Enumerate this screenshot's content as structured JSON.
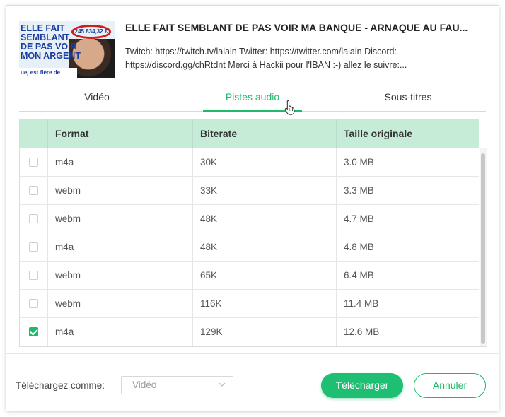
{
  "video": {
    "title": "ELLE FAIT SEMBLANT DE PAS VOIR MA BANQUE - ARNAQUE AU FAU...",
    "description": "Twitch: https://twitch.tv/lalain Twitter: https://twitter.com/lalain Discord: https://discord.gg/chRtdnt Merci à Hackii pour l'IBAN :-) allez le suivre:...",
    "thumbnail": {
      "text": "ELLE FAIT\nSEMBLANT\nDE PAS VOIR\nMON ARGENT",
      "amount": "245 834,32 €",
      "caption": "uej est fière de"
    }
  },
  "tabs": [
    {
      "label": "Vidéo",
      "active": false
    },
    {
      "label": "Pistes audio",
      "active": true
    },
    {
      "label": "Sous-titres",
      "active": false
    }
  ],
  "table": {
    "headers": [
      "Format",
      "Biterate",
      "Taille originale"
    ],
    "rows": [
      {
        "checked": false,
        "format": "m4a",
        "bitrate": "30K",
        "size": "3.0 MB"
      },
      {
        "checked": false,
        "format": "webm",
        "bitrate": "33K",
        "size": "3.3 MB"
      },
      {
        "checked": false,
        "format": "webm",
        "bitrate": "48K",
        "size": "4.7 MB"
      },
      {
        "checked": false,
        "format": "m4a",
        "bitrate": "48K",
        "size": "4.8 MB"
      },
      {
        "checked": false,
        "format": "webm",
        "bitrate": "65K",
        "size": "6.4 MB"
      },
      {
        "checked": false,
        "format": "webm",
        "bitrate": "116K",
        "size": "11.4 MB"
      },
      {
        "checked": true,
        "format": "m4a",
        "bitrate": "129K",
        "size": "12.6 MB"
      }
    ]
  },
  "footer": {
    "download_as_label": "Téléchargez comme:",
    "download_as_value": "Vidéo",
    "download_button": "Télécharger",
    "cancel_button": "Annuler"
  },
  "colors": {
    "accent": "#1fb96a",
    "header_bg": "#c6ecd8"
  }
}
